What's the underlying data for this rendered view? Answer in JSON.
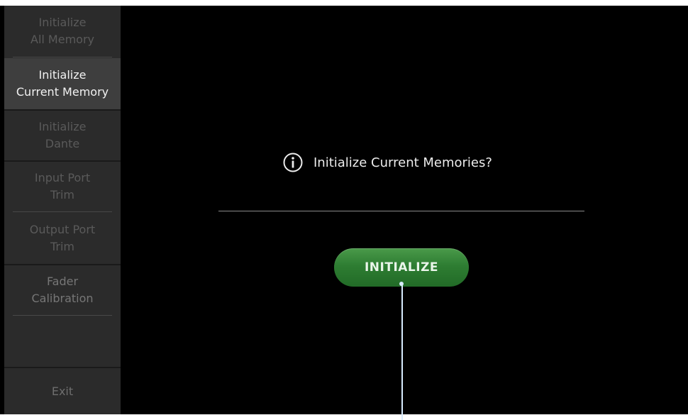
{
  "sidebar": {
    "items": [
      {
        "lines": [
          "Initialize",
          "All Memory"
        ],
        "state": "dim"
      },
      {
        "lines": [
          "Initialize",
          "Current Memory"
        ],
        "state": "active"
      },
      {
        "lines": [
          "Initialize",
          "Dante"
        ],
        "state": "dim"
      },
      {
        "lines": [
          "Input Port",
          "Trim"
        ],
        "state": "dim"
      },
      {
        "lines": [
          "Output Port",
          "Trim"
        ],
        "state": "dim"
      },
      {
        "lines": [
          "Fader",
          "Calibration"
        ],
        "state": "normal"
      }
    ],
    "exit_label": "Exit"
  },
  "dialog": {
    "icon": "info-icon",
    "message": "Initialize Current Memories?",
    "button_label": "INITIALIZE"
  },
  "colors": {
    "background": "#000000",
    "sidebar": "#2b2b2b",
    "sidebar_active": "#3e3e3e",
    "button": "#2e7d32",
    "callout_line": "#d8ecff"
  }
}
